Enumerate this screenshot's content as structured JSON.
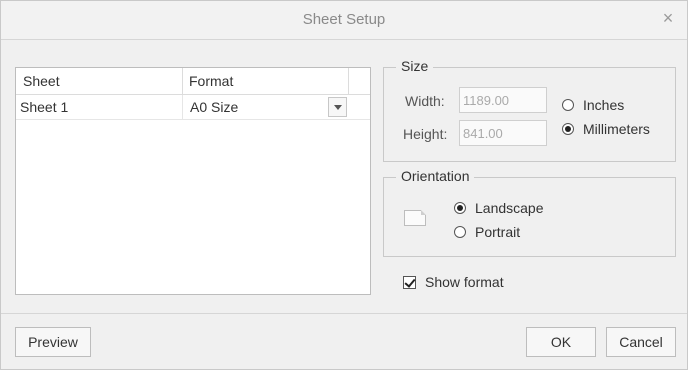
{
  "window": {
    "title": "Sheet Setup",
    "close_glyph": "×"
  },
  "table": {
    "headers": [
      "Sheet",
      "Format"
    ],
    "rows": [
      {
        "sheet": "Sheet 1",
        "format": "A0 Size"
      }
    ]
  },
  "size": {
    "legend": "Size",
    "width_label": "Width:",
    "width_value": "1189.00",
    "height_label": "Height:",
    "height_value": "841.00",
    "units": [
      {
        "label": "Inches",
        "selected": false
      },
      {
        "label": "Millimeters",
        "selected": true
      }
    ]
  },
  "orientation": {
    "legend": "Orientation",
    "options": [
      {
        "label": "Landscape",
        "selected": true
      },
      {
        "label": "Portrait",
        "selected": false
      }
    ],
    "icon": "landscape-page-icon"
  },
  "show_format": {
    "label": "Show format",
    "checked": true
  },
  "buttons": {
    "preview": "Preview",
    "ok": "OK",
    "cancel": "Cancel"
  }
}
